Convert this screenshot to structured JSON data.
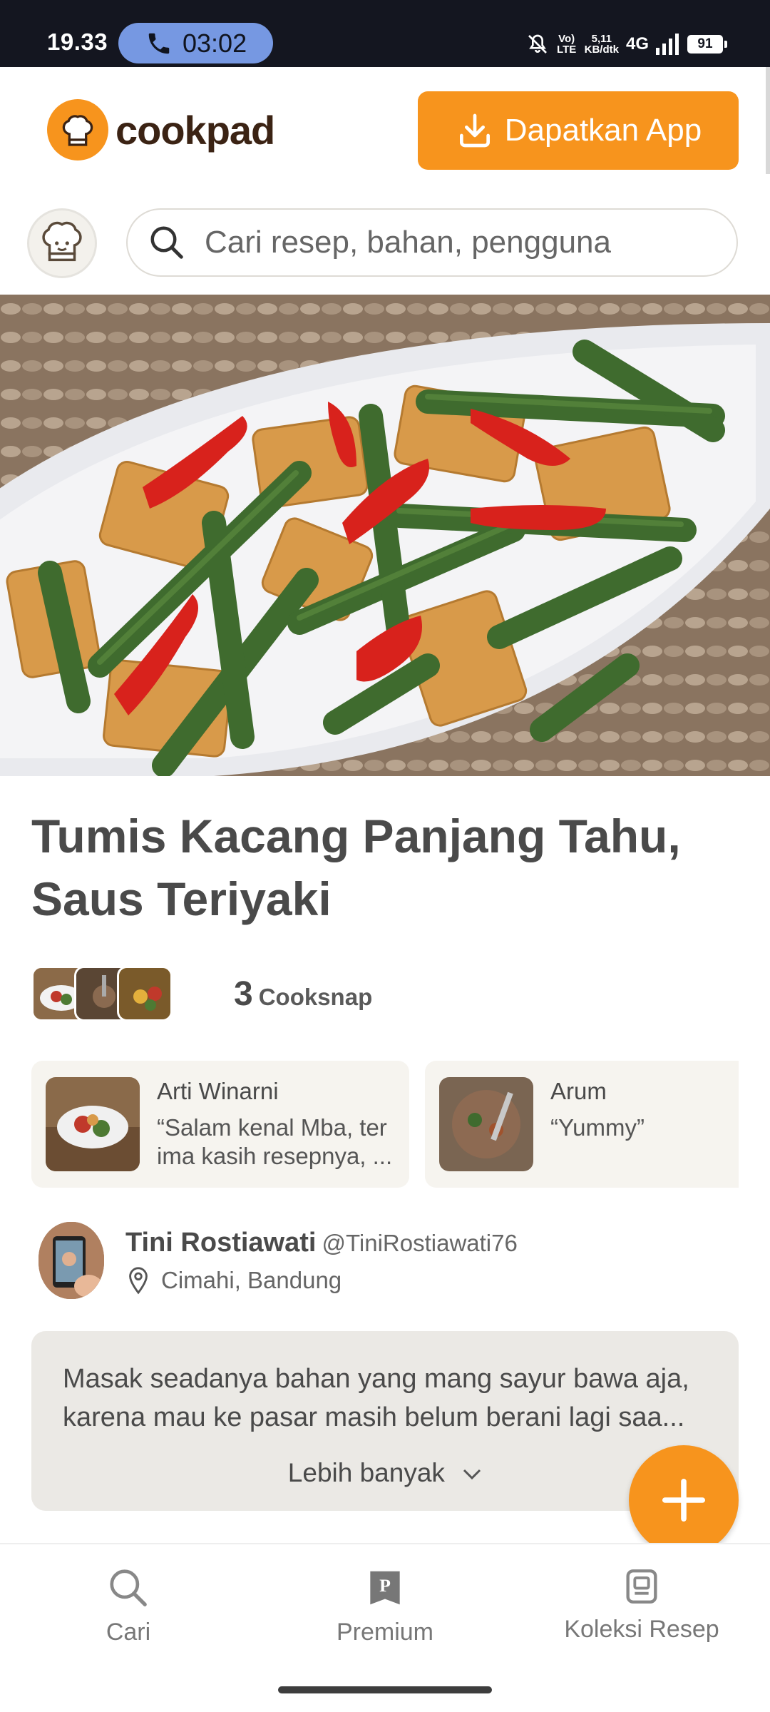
{
  "status_bar": {
    "time": "19.33",
    "call_timer": "03:02",
    "volte": "Vo) LTE",
    "speed_value": "5,11",
    "speed_unit": "KB/dtk",
    "network": "4G",
    "battery": "91"
  },
  "header": {
    "logo_text": "cookpad",
    "get_app_label": "Dapatkan App"
  },
  "search": {
    "placeholder": "Cari resep, bahan, pengguna"
  },
  "recipe": {
    "title": "Tumis Kacang Panjang Tahu, Saus Teriyaki",
    "cooksnap_count": "3",
    "cooksnap_label": "Cooksnap"
  },
  "cooksnap_cards": [
    {
      "name": "Arti Winarni",
      "text": "“Salam kenal Mba, ter ima kasih resepnya, ..."
    },
    {
      "name": "Arum",
      "text": "“Yummy”"
    }
  ],
  "author": {
    "name": "Tini Rostiawati",
    "handle": "@TiniRostiawati76",
    "location": "Cimahi, Bandung"
  },
  "description": {
    "text": "Masak seadanya bahan yang mang sayur bawa aja, karena mau ke pasar masih belum berani lagi saa...",
    "more_label": "Lebih banyak"
  },
  "bottom_nav": [
    {
      "label": "Cari",
      "icon": "search-icon"
    },
    {
      "label": "Premium",
      "icon": "premium-icon"
    },
    {
      "label": "Koleksi Resep",
      "icon": "recipe-collection-icon"
    }
  ],
  "colors": {
    "brand_orange": "#f7941d",
    "status_bar_bg": "#141620",
    "call_pill": "#7698e2",
    "description_bg": "#ebe9e5"
  }
}
